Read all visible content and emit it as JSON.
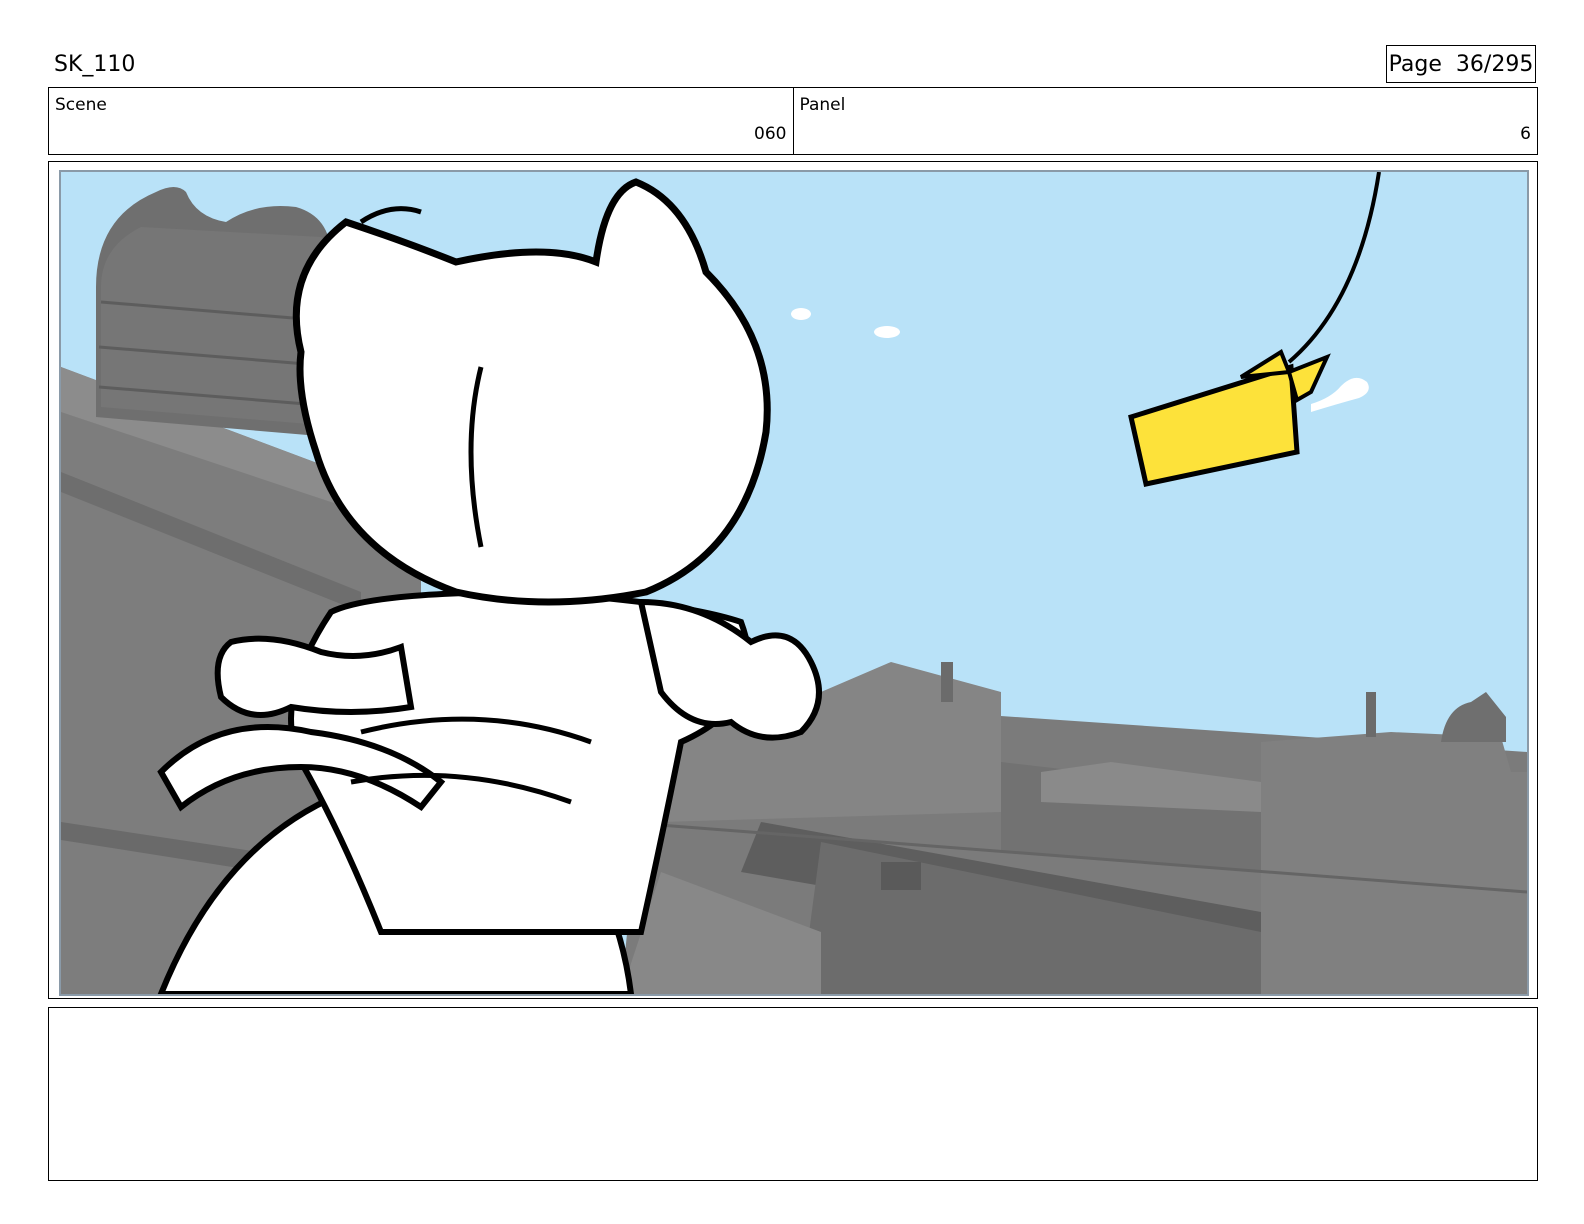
{
  "header": {
    "title": "SK_110",
    "page_label": "Page",
    "page_number": "36/295"
  },
  "info": {
    "scene_label": "Scene",
    "scene_value": "060",
    "panel_label": "Panel",
    "panel_value": "6"
  },
  "panel_image": {
    "description_icon": "storyboard-drawing",
    "sky_color": "#b9e2f8",
    "building_color": "#7b7b7b",
    "kite_color": "#fde23a"
  },
  "notes": {
    "text": ""
  }
}
